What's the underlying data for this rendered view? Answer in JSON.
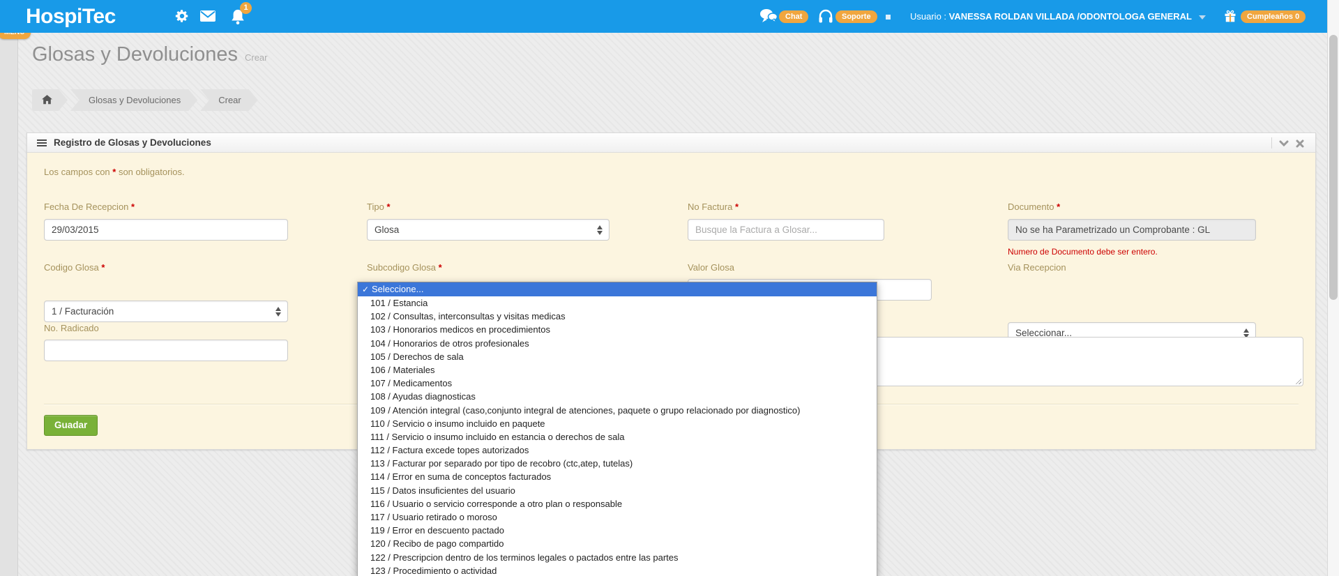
{
  "header": {
    "brand": "HospiTec",
    "notification_count": "1",
    "chat_label": "Chat",
    "support_label": "Soporte",
    "user_prefix": "Usuario : ",
    "user_name": "VANESSA ROLDAN VILLADA /ODONTOLOGA GENERAL",
    "birthday_label": "Cumpleaños 0"
  },
  "sidebar": {
    "menu_label": "MENU",
    "expand_glyph": "›"
  },
  "page": {
    "title": "Glosas y Devoluciones",
    "subtitle": "Crear",
    "breadcrumb": [
      "Glosas y Devoluciones",
      "Crear"
    ]
  },
  "panel": {
    "title": "Registro de Glosas y Devoluciones",
    "note_prefix": "Los campos con ",
    "note_suffix": " son obligatorios.",
    "required_mark": "*"
  },
  "form": {
    "fecha_label": "Fecha De Recepcion",
    "fecha_value": "29/03/2015",
    "tipo_label": "Tipo",
    "tipo_value": "Glosa",
    "factura_label": "No Factura",
    "factura_placeholder": "Busque la Factura a Glosar...",
    "documento_label": "Documento",
    "documento_value": "No se ha Parametrizado un Comprobante : GL",
    "documento_error": "Numero de Documento debe ser entero.",
    "codigo_label": "Codigo Glosa",
    "codigo_value": "1 / Facturación",
    "subcodigo_label": "Subcodigo Glosa",
    "valor_label": "Valor Glosa",
    "via_label": "Via Recepcion",
    "via_value": "Seleccionar...",
    "radicado_label": "No. Radicado",
    "save_label": "Guadar"
  },
  "dropdown": {
    "check_glyph": "✓",
    "selected_label": "Seleccione...",
    "items": [
      "101 / Estancia",
      "102 / Consultas, interconsultas y visitas medicas",
      "103 / Honorarios medicos en procedimientos",
      "104 / Honorarios de otros profesionales",
      "105 / Derechos de sala",
      "106 / Materiales",
      "107 / Medicamentos",
      "108 / Ayudas diagnosticas",
      "109 / Atención integral (caso,conjunto integral de atenciones, paquete o grupo relacionado por diagnostico)",
      "110 / Servicio o insumo incluido en paquete",
      "111 / Servicio o insumo incluido en estancia o derechos de sala",
      "112 / Factura excede topes autorizados",
      "113 / Facturar por separado por tipo de recobro (ctc,atep, tutelas)",
      "114 / Error en suma de conceptos facturados",
      "115 / Datos insuficientes del usuario",
      "116 / Usuario o servicio corresponde a otro plan o responsable",
      "117 / Usuario retirado o moroso",
      "119 / Error en descuento pactado",
      "120 / Recibo de pago compartido",
      "122 / Prescripcion dentro de los terminos legales o pactados entre las partes",
      "123 / Procedimiento o actividad"
    ]
  },
  "colors": {
    "header_blue": "#189ae8",
    "badge_orange": "#f0a63f",
    "panel_cream": "#fcf5e0",
    "label_gold": "#a5925c",
    "error_red": "#cc0000",
    "button_green": "#79b138",
    "highlight_blue": "#3b76d9"
  }
}
